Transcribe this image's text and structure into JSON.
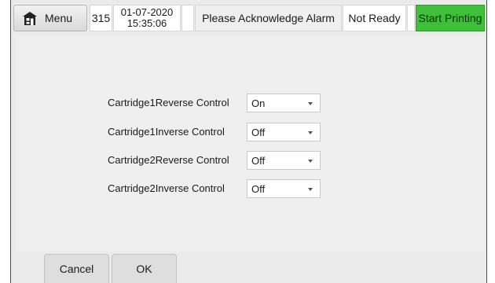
{
  "header": {
    "menu_label": "Menu",
    "job_count": "315",
    "date": "01-07-2020",
    "time": "15:35:06",
    "status_message": "Please Acknowledge Alarm",
    "printer_state": "Not Ready",
    "start_printing_label": "Start Printing"
  },
  "settings": {
    "rows": [
      {
        "label": "Cartridge1Reverse Control",
        "value": "On"
      },
      {
        "label": "Cartridge1Inverse Control",
        "value": "Off"
      },
      {
        "label": "Cartridge2Reverse Control",
        "value": "Off"
      },
      {
        "label": "Cartridge2Inverse Control",
        "value": "Off"
      }
    ]
  },
  "footer": {
    "cancel_label": "Cancel",
    "ok_label": "OK"
  },
  "colors": {
    "start_printing": "#3fbf3a",
    "background": "#ebebeb"
  },
  "icons": {
    "menu": "home-icon",
    "dropdown": "chevron-down-icon"
  }
}
